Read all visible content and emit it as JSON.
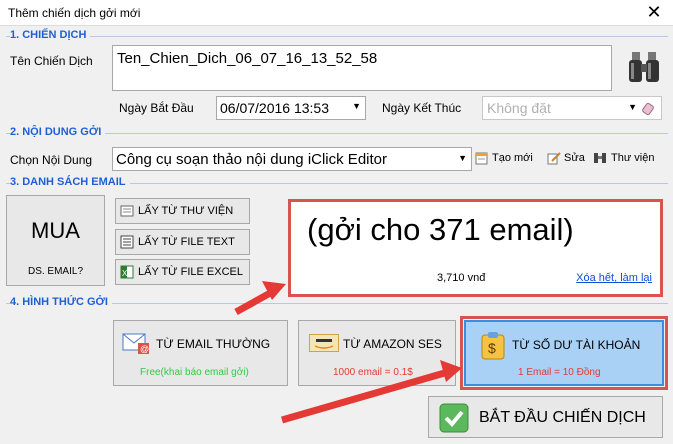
{
  "window": {
    "title": "Thêm chiến dịch gởi mới",
    "close_glyph": "✕"
  },
  "section1": {
    "heading": "1. CHIẾN DỊCH"
  },
  "campaign": {
    "name_label": "Tên Chiến Dịch",
    "name_value": "Ten_Chien_Dich_06_07_16_13_52_58",
    "start_label": "Ngày Bắt Đầu",
    "start_value": "06/07/2016  13:53",
    "end_label": "Ngày Kết Thúc",
    "end_placeholder": "Không đặt"
  },
  "section2": {
    "heading": "2. NỘI DUNG GỞI"
  },
  "content": {
    "choose_label": "Chọn Nội Dung",
    "selected_value": "Công cụ soạn thảo nội dung iClick Editor",
    "new_label": "Tạo mới",
    "edit_label": "Sửa",
    "library_label": "Thư viện"
  },
  "section3": {
    "heading": "3. DANH SÁCH EMAIL"
  },
  "email_list": {
    "buy_big": "MUA",
    "buy_small": "DS. EMAIL?",
    "from_library": "LẤY TỪ THƯ VIỆN",
    "from_text": "LẤY TỪ FILE TEXT",
    "from_excel": "LẤY TỪ FILE EXCEL",
    "count_text": "(gởi cho 371 email)",
    "price_text": "3,710 vnđ",
    "clear_link": "Xóa hết, làm lại"
  },
  "section4": {
    "heading": "4. HÌNH THỨC GỞI"
  },
  "send_methods": [
    {
      "title": "TỪ EMAIL THƯỜNG",
      "sub": "Free(khai báo email gởi)",
      "sub_color": "#2ecc40"
    },
    {
      "title": "TỪ AMAZON SES",
      "sub": "1000 email = 0.1$",
      "sub_color": "#e53935",
      "logo": "amazon"
    },
    {
      "title": "TỪ SỐ DƯ TÀI KHOẢN",
      "sub": "1 Email = 10 Đồng",
      "sub_color": "#e53935"
    }
  ],
  "start": {
    "label": "BẮT ĐẦU CHIẾN DỊCH"
  },
  "colors": {
    "accent_blue": "#1f5fd6",
    "highlight_red": "#e53935",
    "selected_bg": "#a9d0f5"
  },
  "icons": [
    "binoculars-icon",
    "eraser-icon",
    "dropdown-arrow-icon",
    "new-doc-icon",
    "edit-icon",
    "library-icon",
    "mail-icon",
    "dollar-clipboard-icon",
    "checkmark-icon"
  ]
}
